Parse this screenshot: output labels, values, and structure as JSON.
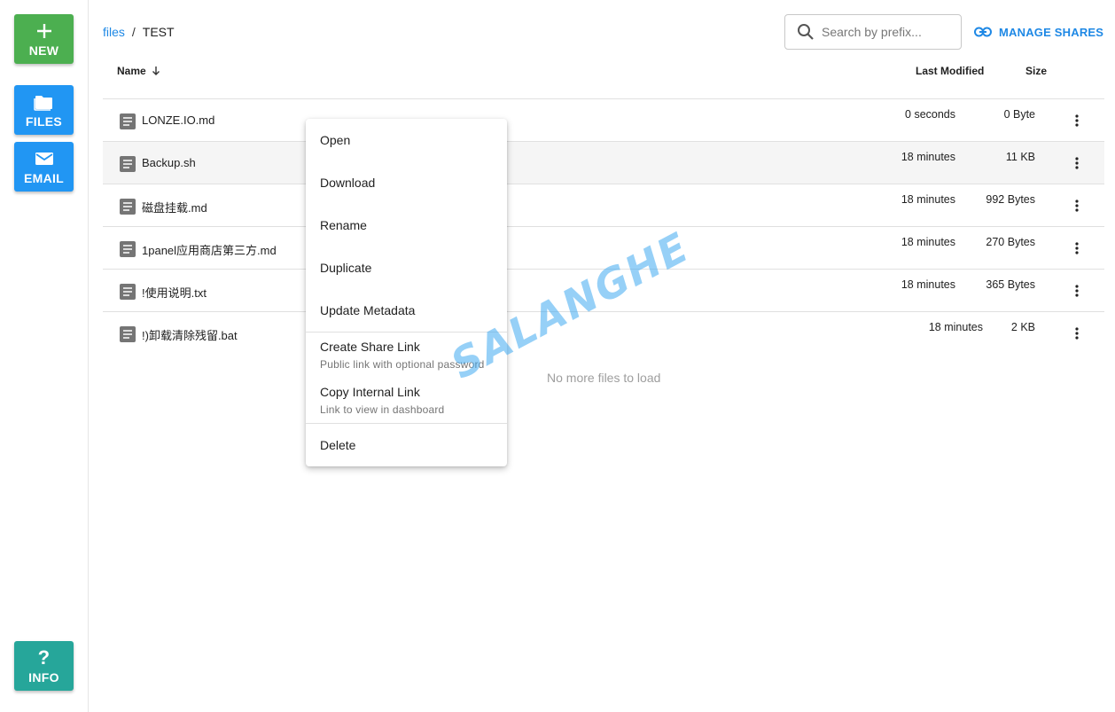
{
  "sidebar": {
    "new_label": "NEW",
    "files_label": "FILES",
    "email_label": "EMAIL",
    "info_label": "INFO",
    "colors": {
      "new": "#4caf50",
      "files": "#2196f3",
      "email": "#2196f3",
      "info": "#26a69a"
    },
    "icons": {
      "new": "plus-icon",
      "files": "folder-icon",
      "email": "mail-icon",
      "info": "question-icon"
    }
  },
  "breadcrumb": {
    "root": "files",
    "separator": "/",
    "current": "TEST"
  },
  "search": {
    "placeholder": "Search by prefix...",
    "icon": "search-icon"
  },
  "manage_shares": {
    "label": "MANAGE SHARES",
    "icon": "link-icon"
  },
  "table": {
    "headers": {
      "name": "Name",
      "last_modified": "Last Modified",
      "size": "Size"
    },
    "sort": {
      "column": "Name",
      "direction": "descending",
      "icon": "arrow-down-icon"
    },
    "rows": [
      {
        "name": "LONZE.IO.md",
        "modified": "0 seconds",
        "size": "0 Byte"
      },
      {
        "name": "Backup.sh",
        "modified": "18 minutes",
        "size": "11 KB"
      },
      {
        "name": "磁盘挂载.md",
        "modified": "18 minutes",
        "size": "992 Bytes"
      },
      {
        "name": "1panel应用商店第三方.md",
        "modified": "18 minutes",
        "size": "270 Bytes"
      },
      {
        "name": "!使用说明.txt",
        "modified": "18 minutes",
        "size": "365 Bytes"
      },
      {
        "name": "!)卸载清除残留.bat",
        "modified": "18 minutes",
        "size": "2 KB"
      }
    ],
    "footer": "No more files to load"
  },
  "context_menu": {
    "open": "Open",
    "download": "Download",
    "rename": "Rename",
    "duplicate": "Duplicate",
    "update_metadata": "Update Metadata",
    "create_share_link": "Create Share Link",
    "create_share_link_sub": "Public link with optional password",
    "copy_internal_link": "Copy Internal Link",
    "copy_internal_link_sub": "Link to view in dashboard",
    "delete": "Delete"
  },
  "watermark": "SALANGHE",
  "accent_color": "#1e88e5"
}
